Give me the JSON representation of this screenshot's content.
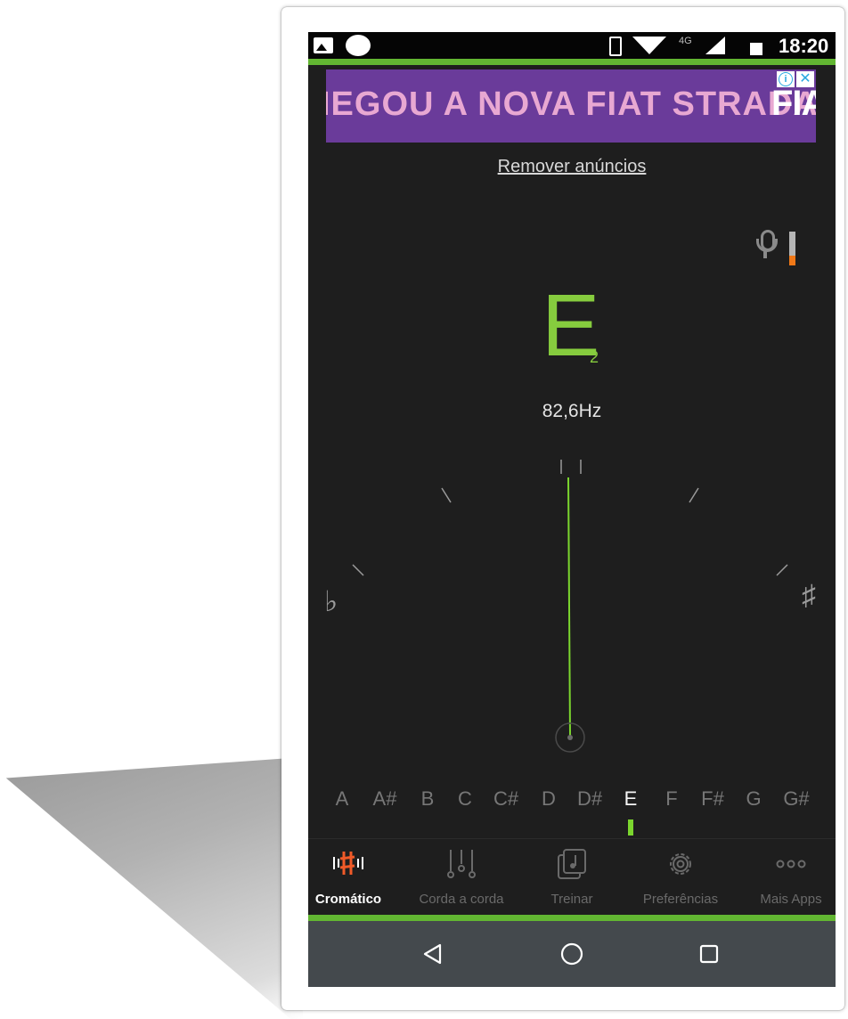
{
  "status_bar": {
    "network": "4G",
    "time": "18:20"
  },
  "ad": {
    "text": "IEGOU A NOVA FIAT STRADA.",
    "logo": "FIAT",
    "info_icon": "info-icon",
    "close_icon": "close-icon",
    "colors": {
      "background": "#6a3b9a",
      "text": "#e8a8d2"
    }
  },
  "remove_ads": "Remover anúncios",
  "mic_level": 0.3,
  "tuner": {
    "note": "E",
    "octave": "2",
    "frequency": "82,6Hz",
    "flat_symbol": "♭",
    "sharp_symbol": "♯",
    "accent_color": "#86cc3e"
  },
  "note_scale": [
    "A",
    "A#",
    "B",
    "C",
    "C#",
    "D",
    "D#",
    "E",
    "F",
    "F#",
    "G",
    "G#"
  ],
  "active_note": "E",
  "bottom_nav": [
    {
      "label": "Cromático",
      "icon": "chromatic-icon",
      "active": true
    },
    {
      "label": "Corda a corda",
      "icon": "strings-icon",
      "active": false
    },
    {
      "label": "Treinar",
      "icon": "train-icon",
      "active": false
    },
    {
      "label": "Preferências",
      "icon": "gear-icon",
      "active": false
    },
    {
      "label": "Mais Apps",
      "icon": "more-apps-icon",
      "active": false
    }
  ],
  "system_nav": [
    "back-icon",
    "home-icon",
    "recents-icon"
  ]
}
